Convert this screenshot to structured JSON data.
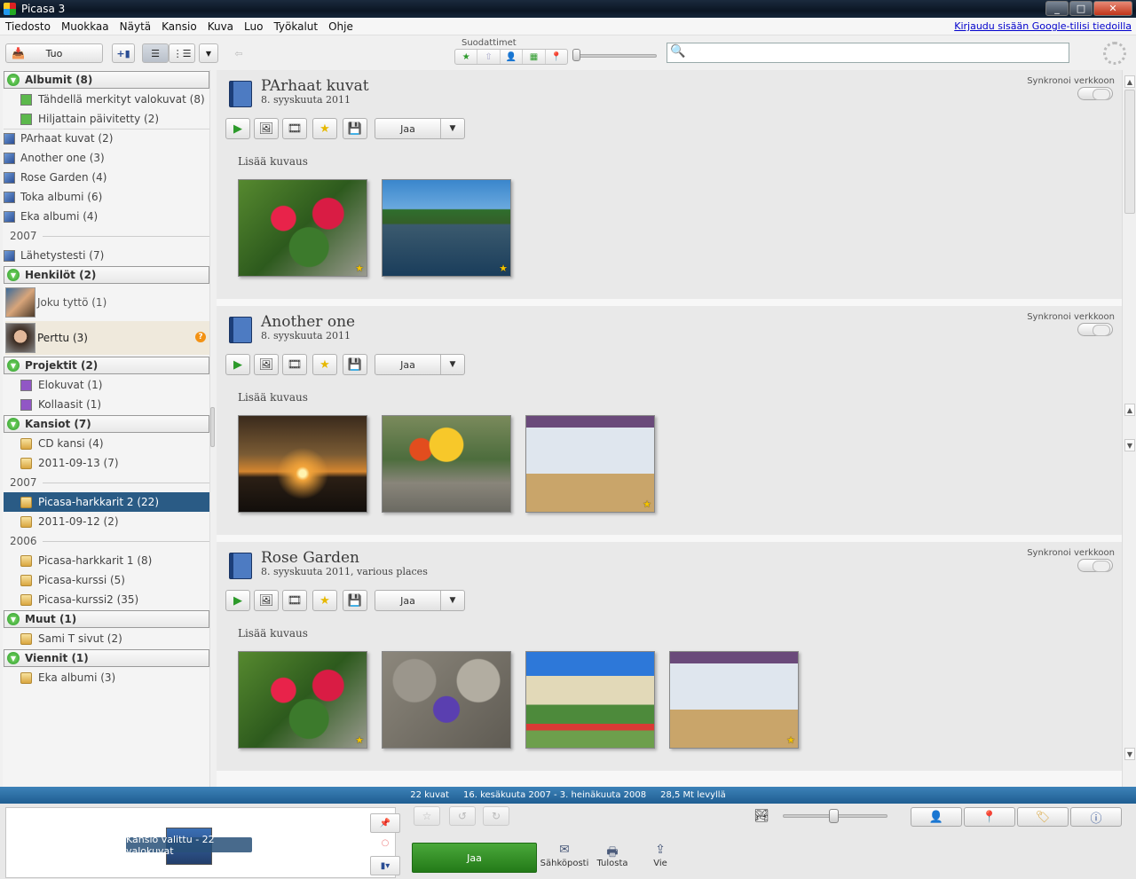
{
  "window": {
    "title": "Picasa 3"
  },
  "menu": {
    "items": [
      "Tiedosto",
      "Muokkaa",
      "Näytä",
      "Kansio",
      "Kuva",
      "Luo",
      "Työkalut",
      "Ohje"
    ],
    "signin": "Kirjaudu sisään Google-tilisi tiedoilla"
  },
  "toolbar": {
    "import_label": "Tuo",
    "filters_label": "Suodattimet",
    "search_placeholder": ""
  },
  "sidebar": {
    "albums_header": "Albumit (8)",
    "albums": [
      {
        "label": "Tähdellä merkityt valokuvat (8)",
        "icon": "star-album-icon"
      },
      {
        "label": "Hiljattain päivitetty (2)",
        "icon": "star-album-icon"
      },
      {
        "label": "PArhaat kuvat (2)",
        "icon": "album-icon"
      },
      {
        "label": "Another one (3)",
        "icon": "album-icon"
      },
      {
        "label": "Rose Garden (4)",
        "icon": "album-icon"
      },
      {
        "label": "Toka albumi (6)",
        "icon": "album-icon"
      },
      {
        "label": "Eka albumi (4)",
        "icon": "album-icon"
      }
    ],
    "albums_year": "2007",
    "albums_2007": [
      {
        "label": "Lähetystesti (7)"
      }
    ],
    "people_header": "Henkilöt (2)",
    "people": [
      {
        "label": "Joku tyttö (1)"
      },
      {
        "label": "Perttu (3)",
        "badge": "?"
      }
    ],
    "projects_header": "Projektit (2)",
    "projects": [
      {
        "label": "Elokuvat (1)"
      },
      {
        "label": "Kollaasit (1)"
      }
    ],
    "folders_header": "Kansiot (7)",
    "folders": [
      {
        "label": "CD kansi (4)"
      },
      {
        "label": "2011-09-13 (7)"
      }
    ],
    "folders_year_a": "2007",
    "folders_2007": [
      {
        "label": "Picasa-harkkarit 2 (22)",
        "selected": true
      },
      {
        "label": "2011-09-12 (2)"
      }
    ],
    "folders_year_b": "2006",
    "folders_2006": [
      {
        "label": "Picasa-harkkarit 1 (8)"
      },
      {
        "label": "Picasa-kurssi (5)"
      },
      {
        "label": "Picasa-kurssi2 (35)"
      }
    ],
    "other_header": "Muut (1)",
    "other": [
      {
        "label": "Sami T sivut (2)"
      }
    ],
    "exports_header": "Viennit (1)",
    "exports": [
      {
        "label": "Eka albumi (3)"
      }
    ]
  },
  "albums": [
    {
      "title": "PArhaat kuvat",
      "date": "8. syyskuuta 2011",
      "sync_label": "Synkronoi verkkoon",
      "share_label": "Jaa",
      "add_description": "Lisää kuvaus",
      "photos": [
        {
          "style": "p-rose",
          "starred": true
        },
        {
          "style": "p-lake",
          "starred": true
        }
      ]
    },
    {
      "title": "Another one",
      "date": "8. syyskuuta 2011",
      "sync_label": "Synkronoi verkkoon",
      "share_label": "Jaa",
      "add_description": "Lisää kuvaus",
      "photos": [
        {
          "style": "p-sunset",
          "starred": false
        },
        {
          "style": "p-flowers",
          "starred": false
        },
        {
          "style": "p-mall",
          "starred": true
        }
      ]
    },
    {
      "title": "Rose Garden",
      "date": "8. syyskuuta 2011, various places",
      "sync_label": "Synkronoi verkkoon",
      "share_label": "Jaa",
      "add_description": "Lisää kuvaus",
      "photos": [
        {
          "style": "p-rose",
          "starred": true
        },
        {
          "style": "p-stones",
          "starred": false
        },
        {
          "style": "p-park",
          "starred": false
        },
        {
          "style": "p-mall",
          "starred": true
        }
      ]
    }
  ],
  "status": {
    "count": "22 kuvat",
    "range": "16. kesäkuuta 2007 - 3. heinäkuuta 2008",
    "disk": "28,5 Mt levyllä"
  },
  "tray": {
    "selection_label": "Kansio valittu - 22 valokuvat",
    "share_label": "Jaa",
    "email_label": "Sähköposti",
    "print_label": "Tulosta",
    "export_label": "Vie"
  },
  "colors": {
    "selection": "#2a5b85",
    "status_bar": "#2f72a8",
    "share_green": "#349426",
    "star": "#f5c400"
  }
}
